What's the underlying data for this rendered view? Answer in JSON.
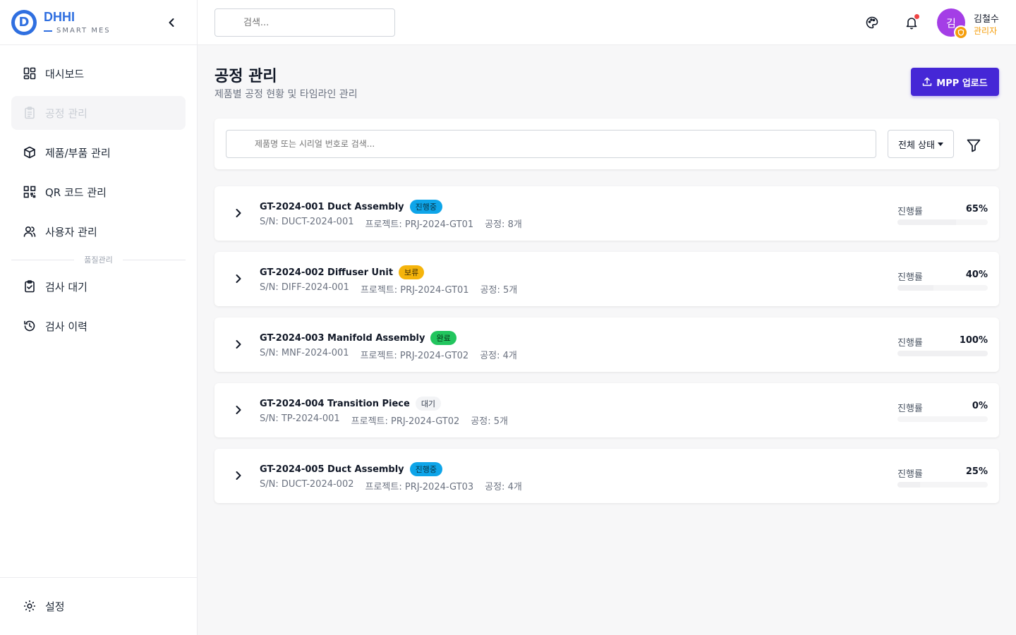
{
  "brand": {
    "name": "DHHI",
    "sub": "SMART MES",
    "logo_letter": "D"
  },
  "search": {
    "placeholder": "검색..."
  },
  "sidebar": {
    "items": [
      {
        "label": "대시보드",
        "icon": "dashboard-icon",
        "active": false
      },
      {
        "label": "공정 관리",
        "icon": "clipboard-icon",
        "active": true
      },
      {
        "label": "제품/부품 관리",
        "icon": "box-icon",
        "active": false
      },
      {
        "label": "QR 코드 관리",
        "icon": "qr-icon",
        "active": false
      },
      {
        "label": "사용자 관리",
        "icon": "users-icon",
        "active": false
      }
    ],
    "section_label": "품질관리",
    "quality_items": [
      {
        "label": "검사 대기",
        "icon": "clipboard-check-icon"
      },
      {
        "label": "검사 이력",
        "icon": "history-icon"
      }
    ],
    "settings_label": "설정"
  },
  "user": {
    "avatar_letter": "김",
    "name": "김철수",
    "role": "관리자"
  },
  "page": {
    "title": "공정 관리",
    "subtitle": "제품별 공정 현황 및 타임라인 관리",
    "upload_label": "MPP 업로드"
  },
  "filter": {
    "search_placeholder": "제품명 또는 시리얼 번호로 검색...",
    "status_label": "전체 상태"
  },
  "colors": {
    "accent": "#4527d6",
    "brand": "#2f6fe0"
  },
  "processes": [
    {
      "name": "GT-2024-001 Duct Assembly",
      "status": "진행중",
      "status_bg": "#0ea5e9",
      "status_fg": "#083344",
      "sn": "S/N: DUCT-2024-001",
      "project": "프로젝트: PRJ-2024-GT01",
      "steps": "공정: 8개",
      "progress_label": "진행률",
      "progress": "65%",
      "progress_value": 65
    },
    {
      "name": "GT-2024-002 Diffuser Unit",
      "status": "보류",
      "status_bg": "#f5b40b",
      "status_fg": "#3b2a02",
      "sn": "S/N: DIFF-2024-001",
      "project": "프로젝트: PRJ-2024-GT01",
      "steps": "공정: 5개",
      "progress_label": "진행률",
      "progress": "40%",
      "progress_value": 40
    },
    {
      "name": "GT-2024-003 Manifold Assembly",
      "status": "완료",
      "status_bg": "#22c55e",
      "status_fg": "#052e16",
      "sn": "S/N: MNF-2024-001",
      "project": "프로젝트: PRJ-2024-GT02",
      "steps": "공정: 4개",
      "progress_label": "진행률",
      "progress": "100%",
      "progress_value": 100
    },
    {
      "name": "GT-2024-004 Transition Piece",
      "status": "대기",
      "status_bg": "#f3f4f6",
      "status_fg": "#374151",
      "sn": "S/N: TP-2024-001",
      "project": "프로젝트: PRJ-2024-GT02",
      "steps": "공정: 5개",
      "progress_label": "진행률",
      "progress": "0%",
      "progress_value": 0
    },
    {
      "name": "GT-2024-005 Duct Assembly",
      "status": "진행중",
      "status_bg": "#0ea5e9",
      "status_fg": "#083344",
      "sn": "S/N: DUCT-2024-002",
      "project": "프로젝트: PRJ-2024-GT03",
      "steps": "공정: 4개",
      "progress_label": "진행률",
      "progress": "25%",
      "progress_value": 25
    }
  ]
}
